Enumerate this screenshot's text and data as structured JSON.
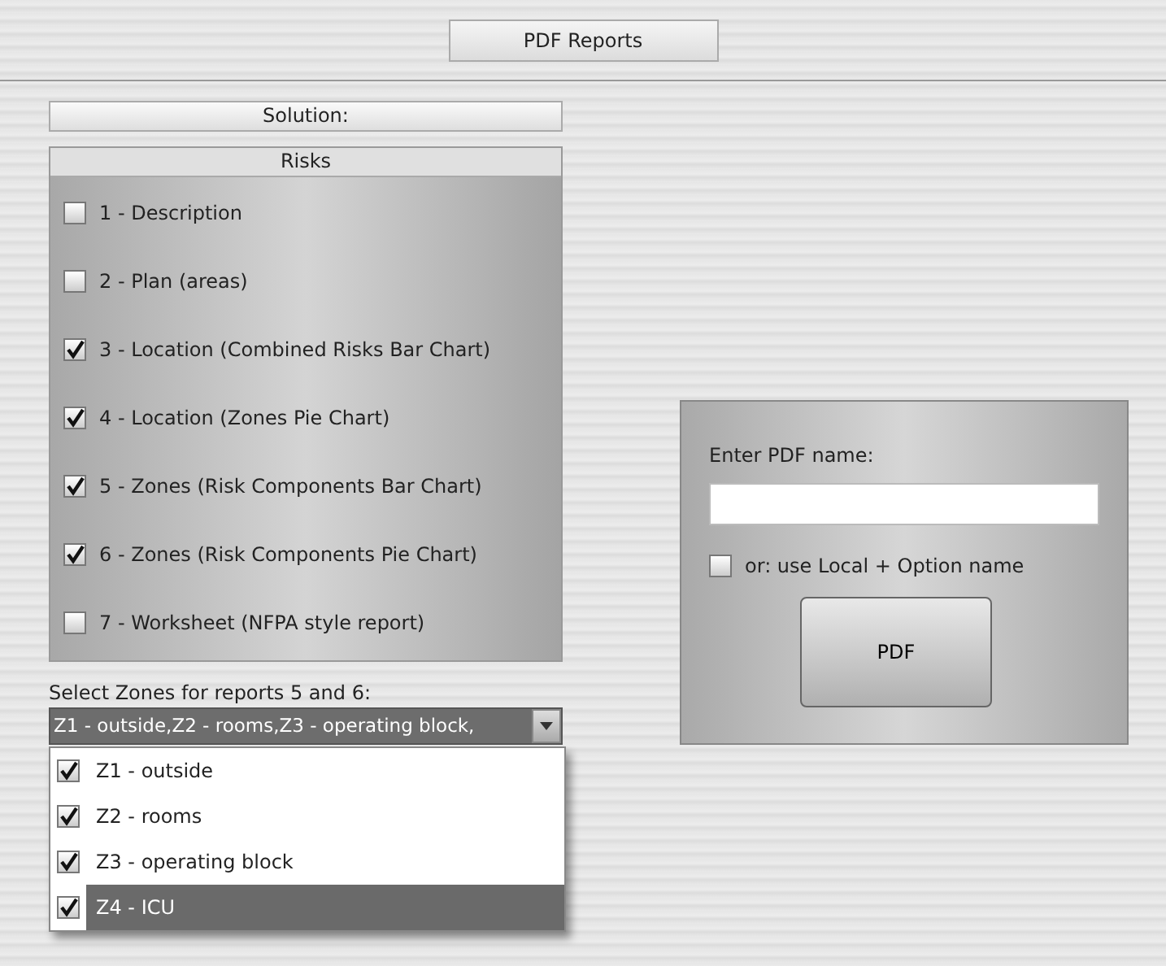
{
  "title": "PDF Reports",
  "solution": {
    "label": "Solution:"
  },
  "risks": {
    "title": "Risks",
    "items": [
      {
        "label": "1 - Description",
        "checked": false
      },
      {
        "label": "2 - Plan (areas)",
        "checked": false
      },
      {
        "label": "3 - Location (Combined Risks Bar Chart)",
        "checked": true
      },
      {
        "label": "4 - Location (Zones Pie Chart)",
        "checked": true
      },
      {
        "label": "5 - Zones (Risk Components Bar Chart)",
        "checked": true
      },
      {
        "label": "6 - Zones (Risk Components Pie Chart)",
        "checked": true
      },
      {
        "label": "7 - Worksheet (NFPA style report)",
        "checked": false
      }
    ]
  },
  "zones": {
    "label": "Select Zones for reports 5 and 6:",
    "value": "Z1 - outside,Z2 - rooms,Z3 - operating block,",
    "expanded": true,
    "options": [
      {
        "label": "Z1 - outside",
        "checked": true,
        "selected": false
      },
      {
        "label": "Z2 - rooms",
        "checked": true,
        "selected": false
      },
      {
        "label": "Z3 - operating block",
        "checked": true,
        "selected": false
      },
      {
        "label": "Z4 - ICU",
        "checked": true,
        "selected": true
      }
    ]
  },
  "pdf": {
    "label": "Enter PDF name:",
    "local_option": {
      "label": "or: use Local + Option name",
      "checked": false
    },
    "button": "PDF"
  }
}
